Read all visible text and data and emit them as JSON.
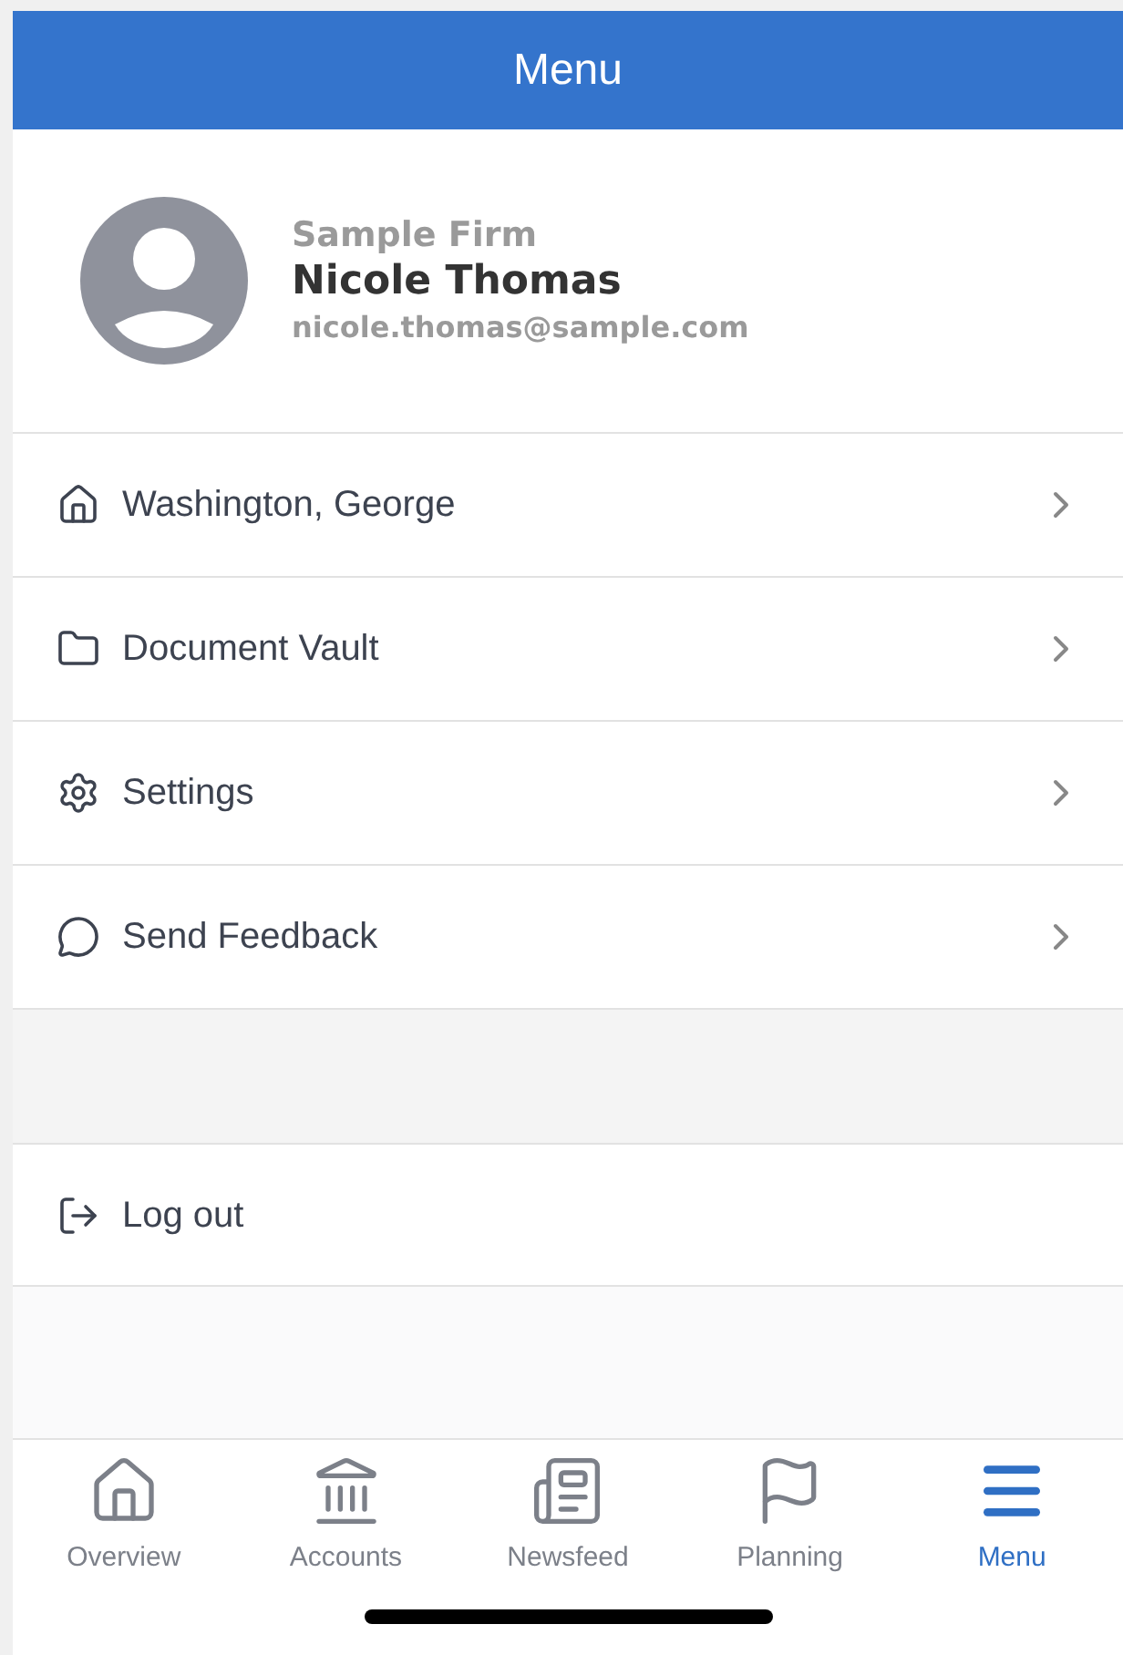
{
  "header": {
    "title": "Menu"
  },
  "profile": {
    "firm": "Sample Firm",
    "name": "Nicole Thomas",
    "email": "nicole.thomas@sample.com"
  },
  "menu_items": [
    {
      "label": "Washington, George",
      "kind": "link"
    },
    {
      "label": "Document Vault",
      "kind": "link"
    },
    {
      "label": "Settings",
      "kind": "link"
    },
    {
      "label": "Send Feedback",
      "kind": "link"
    }
  ],
  "logout": {
    "label": "Log out"
  },
  "tab_bar": [
    {
      "label": "Overview",
      "selected": false
    },
    {
      "label": "Accounts",
      "selected": false
    },
    {
      "label": "Newsfeed",
      "selected": false
    },
    {
      "label": "Planning",
      "selected": false
    },
    {
      "label": "Menu",
      "selected": true
    }
  ]
}
